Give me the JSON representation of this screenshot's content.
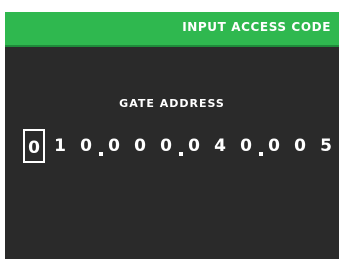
{
  "header": {
    "title": "INPUT ACCESS CODE"
  },
  "gate": {
    "label": "GATE ADDRESS",
    "digits": [
      "0",
      "1",
      "0",
      "0",
      "0",
      "0",
      "0",
      "4",
      "0",
      "0",
      "0",
      "5"
    ],
    "selected_index": 0
  },
  "colors": {
    "header_bg": "#2fb84f",
    "body_bg": "#2a2a2a",
    "text": "#ffffff"
  }
}
